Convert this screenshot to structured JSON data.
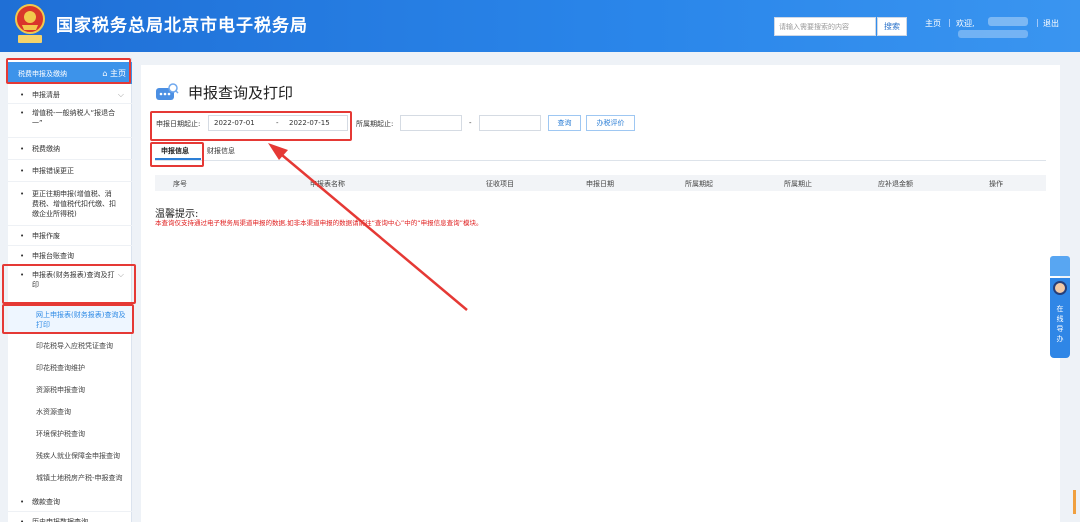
{
  "header": {
    "site_title": "国家税务总局北京市电子税务局",
    "search_placeholder": "请输入需要搜索的内容",
    "search_button": "搜索",
    "home_link": "主页",
    "welcome": "欢迎,",
    "logout": "退出",
    "brand_color": "#2a86ea"
  },
  "sidebar": {
    "top_label": "税费申报及缴纳",
    "top_home": "主页",
    "items": [
      {
        "label": "申报清册",
        "chevron": true
      },
      {
        "label": "增值税-一般纳税人“报退合一”",
        "chevron": false
      },
      {
        "label": "税费缴纳",
        "chevron": false
      },
      {
        "label": "申报错误更正",
        "chevron": false
      },
      {
        "label": "更正往期申报(增值税、消费税、增值税代扣代缴、扣缴企业所得税)",
        "chevron": false
      },
      {
        "label": "申报作废",
        "chevron": false
      },
      {
        "label": "申报台账查询",
        "chevron": false
      },
      {
        "label": "申报表(财务报表)查询及打印",
        "chevron": true
      }
    ],
    "sub_items": [
      {
        "label": "网上申报表(财务报表)查询及打印",
        "active": true
      },
      {
        "label": "印花税导入应税凭证查询",
        "active": false
      },
      {
        "label": "印花税查询维护",
        "active": false
      },
      {
        "label": "资源税申报查询",
        "active": false
      },
      {
        "label": "水资源查询",
        "active": false
      },
      {
        "label": "环境保护税查询",
        "active": false
      },
      {
        "label": "残疾人就业保障金申报查询",
        "active": false
      },
      {
        "label": "城镇土地税房产税-申报查询",
        "active": false
      }
    ],
    "bottom_items": [
      {
        "label": "缴款查询"
      },
      {
        "label": "历史申报数据查询"
      }
    ]
  },
  "main": {
    "page_title": "申报查询及打印",
    "filter": {
      "date_label": "申报日期起止:",
      "date_from": "2022-07-01",
      "date_to": "2022-07-15",
      "dash": "-",
      "period_label": "所属期起止:",
      "period_from": "",
      "period_to": "",
      "query_button": "查询",
      "evaluate_button": "办税评价"
    },
    "tabs": [
      {
        "label": "申报信息",
        "active": true
      },
      {
        "label": "财报信息",
        "active": false
      }
    ],
    "table_headers": [
      "序号",
      "申报表名称",
      "征收项目",
      "申报日期",
      "所属期起",
      "所属期止",
      "应补退金额",
      "操作"
    ],
    "tip_title": "温馨提示:",
    "tip_text": "本查询仅支持通过电子税务局渠道申报的数据,如非本渠道申报的数据请前往“查询中心”中的“申报信息查询”模块。"
  },
  "float_widget": {
    "label_chars": [
      "在",
      "线",
      "导",
      "办"
    ]
  },
  "annotation_color": "#e53935"
}
